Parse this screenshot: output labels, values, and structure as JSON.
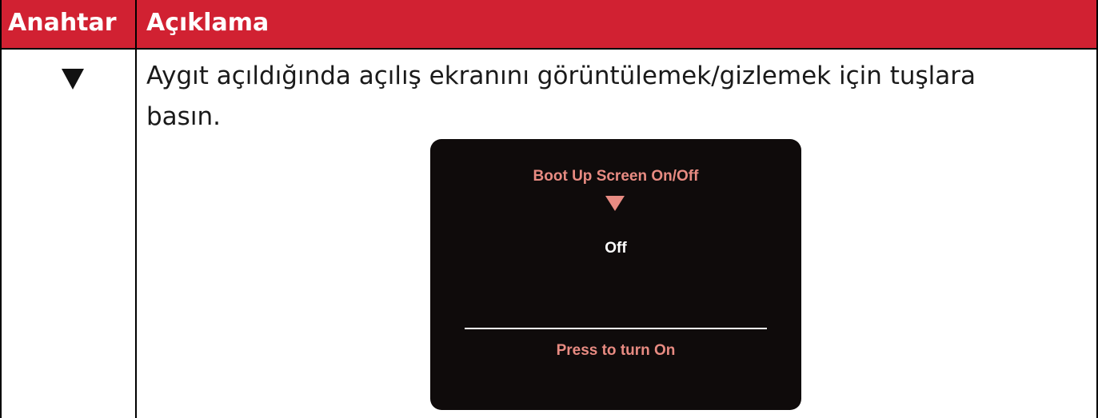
{
  "table": {
    "header": {
      "key": "Anahtar",
      "description": "Açıklama"
    },
    "row": {
      "key_icon": "down-triangle-icon",
      "description": "Aygıt açıldığında açılış ekranını görüntülemek/gizlemek için tuşlara basın."
    }
  },
  "osd": {
    "title": "Boot Up Screen On/Off",
    "arrow_icon": "down-triangle-icon",
    "value": "Off",
    "hint": "Press to turn On"
  },
  "colors": {
    "header_bg": "#d12132",
    "header_text": "#ffffff",
    "osd_bg": "#0f0b0b",
    "osd_accent": "#e88b82"
  }
}
